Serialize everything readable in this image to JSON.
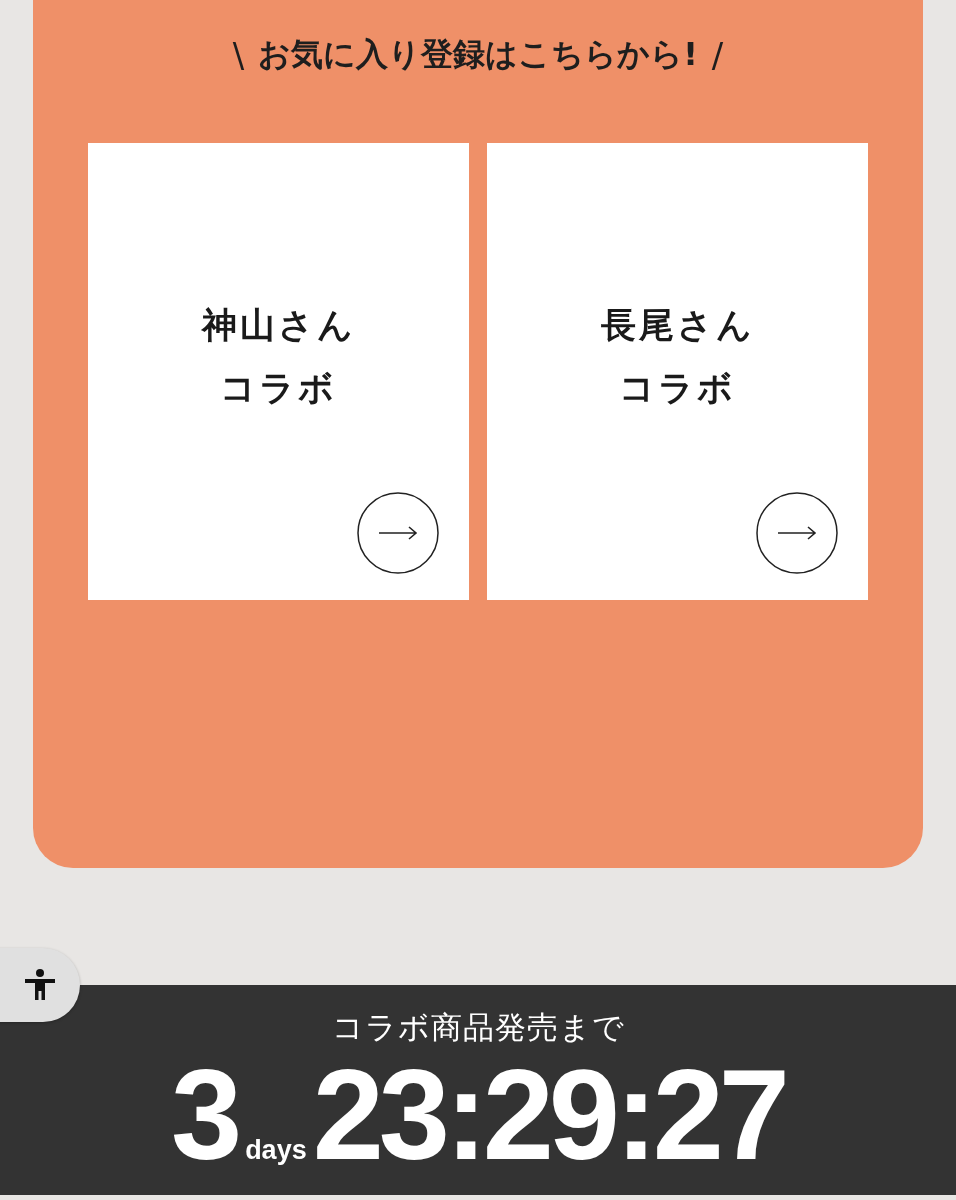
{
  "heading": {
    "open_mark": "\\",
    "text": "お気に入り登録はこちらから!",
    "close_mark": "/"
  },
  "cards": [
    {
      "title_lines": [
        "神山さん",
        "コラボ"
      ]
    },
    {
      "title_lines": [
        "長尾さん",
        "コラボ"
      ]
    }
  ],
  "countdown": {
    "label": "コラボ商品発売まで",
    "days": "3",
    "days_unit": "days",
    "time": "23:29:27"
  }
}
